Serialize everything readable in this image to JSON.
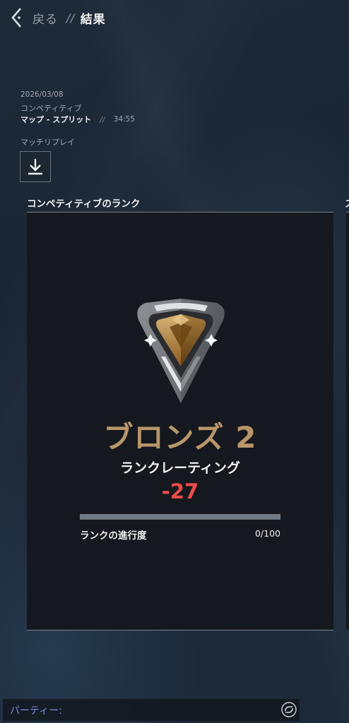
{
  "header": {
    "back_label": "戻る",
    "separator": "//",
    "title": "結果"
  },
  "match": {
    "date": "2026/03/08",
    "mode": "コンペティティブ",
    "map": "マップ - スプリット",
    "separator": "//",
    "duration": "34:55",
    "replay_label": "マッチリプレイ",
    "replay_icon": "download-icon"
  },
  "rank_panel": {
    "title": "コンペティティブのランク",
    "rank_name": "ブロンズ 2",
    "rank_emblem_icon": "bronze-rank-emblem",
    "rank_color": "#b8966a",
    "rr_label": "ランクレーティング",
    "rr_change": "-27",
    "rr_change_color": "#ee4c4c",
    "progress_label": "ランクの進行度",
    "progress_value": "0/100",
    "progress_fraction": 0
  },
  "party": {
    "label": "パーティー:",
    "icon": "party-link-icon"
  }
}
